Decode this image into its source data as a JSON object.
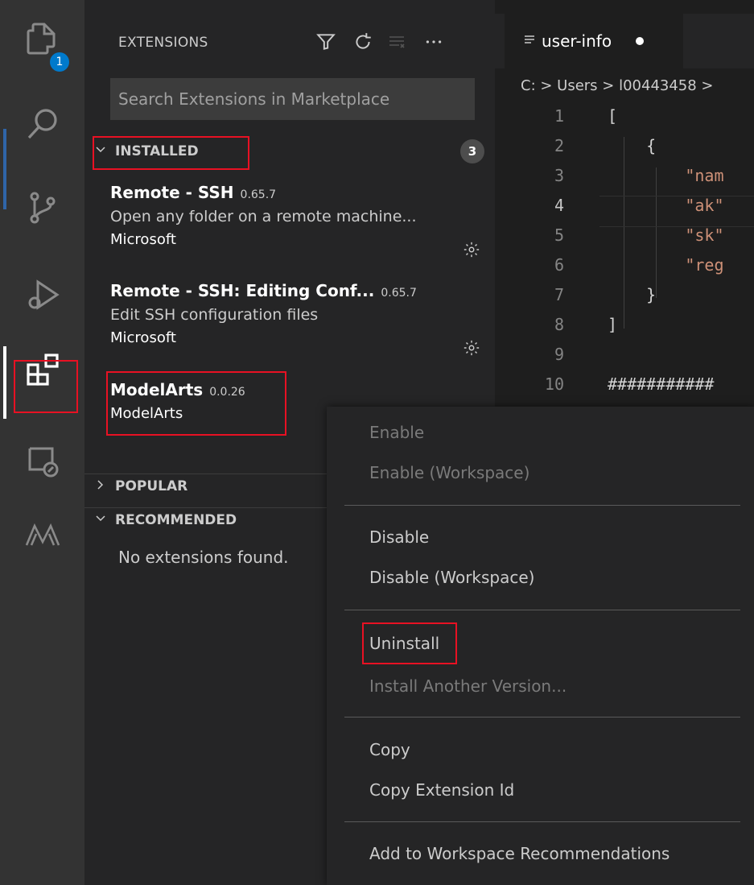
{
  "activity_bar": {
    "explorer_badge": "1"
  },
  "sidebar": {
    "title": "EXTENSIONS",
    "search_placeholder": "Search Extensions in Marketplace",
    "installed": {
      "label": "INSTALLED",
      "count": "3",
      "extensions": [
        {
          "name": "Remote - SSH",
          "version": "0.65.7",
          "description": "Open any folder on a remote machine...",
          "publisher": "Microsoft"
        },
        {
          "name": "Remote - SSH: Editing Conf...",
          "version": "0.65.7",
          "description": "Edit SSH configuration files",
          "publisher": "Microsoft"
        },
        {
          "name": "ModelArts",
          "version": "0.0.26",
          "description": "",
          "publisher": "ModelArts"
        }
      ]
    },
    "popular": {
      "label": "POPULAR"
    },
    "recommended": {
      "label": "RECOMMENDED",
      "empty_message": "No extensions found."
    }
  },
  "editor": {
    "tab_label": "user-info",
    "breadcrumb": "C: > Users > l00443458 >",
    "lines": [
      {
        "n": "1",
        "text": "["
      },
      {
        "n": "2",
        "text": "    {"
      },
      {
        "n": "3",
        "text": "        \"nam"
      },
      {
        "n": "4",
        "text": "        \"ak\""
      },
      {
        "n": "5",
        "text": "        \"sk\""
      },
      {
        "n": "6",
        "text": "        \"reg"
      },
      {
        "n": "7",
        "text": "    }"
      },
      {
        "n": "8",
        "text": "]"
      },
      {
        "n": "9",
        "text": ""
      },
      {
        "n": "10",
        "text": "###########"
      }
    ]
  },
  "context_menu": {
    "items": [
      {
        "label": "Enable",
        "enabled": false
      },
      {
        "label": "Enable (Workspace)",
        "enabled": false
      },
      {
        "label": "Disable",
        "enabled": true
      },
      {
        "label": "Disable (Workspace)",
        "enabled": true
      },
      {
        "label": "Uninstall",
        "enabled": true
      },
      {
        "label": "Install Another Version...",
        "enabled": false
      },
      {
        "label": "Copy",
        "enabled": true
      },
      {
        "label": "Copy Extension Id",
        "enabled": true
      },
      {
        "label": "Add to Workspace Recommendations",
        "enabled": true
      }
    ]
  },
  "colors": {
    "activity_bar": "#333333",
    "sidebar": "#252526",
    "editor": "#1e1e1e",
    "badge": "#007acc",
    "highlight": "#e81123",
    "string": "#ce9178"
  },
  "icons": {
    "activity": [
      "explorer-icon",
      "search-icon",
      "source-control-icon",
      "run-debug-icon",
      "extensions-icon",
      "remote-explorer-icon",
      "modelarts-icon"
    ],
    "sidebar_toolbar": [
      "filter-icon",
      "refresh-icon",
      "clear-icon",
      "more-icon"
    ]
  }
}
